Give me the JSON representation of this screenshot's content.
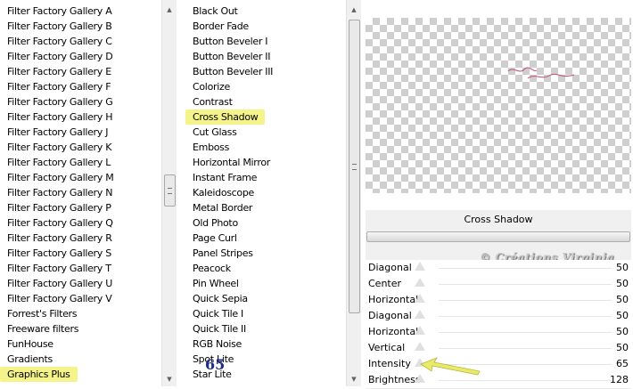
{
  "categories": {
    "items": [
      "Filter Factory Gallery A",
      "Filter Factory Gallery B",
      "Filter Factory Gallery C",
      "Filter Factory Gallery D",
      "Filter Factory Gallery E",
      "Filter Factory Gallery F",
      "Filter Factory Gallery G",
      "Filter Factory Gallery H",
      "Filter Factory Gallery J",
      "Filter Factory Gallery K",
      "Filter Factory Gallery L",
      "Filter Factory Gallery M",
      "Filter Factory Gallery N",
      "Filter Factory Gallery P",
      "Filter Factory Gallery Q",
      "Filter Factory Gallery R",
      "Filter Factory Gallery S",
      "Filter Factory Gallery T",
      "Filter Factory Gallery U",
      "Filter Factory Gallery V",
      "Forrest's Filters",
      "Freeware filters",
      "FunHouse",
      "Gradients",
      "Graphics Plus"
    ],
    "selected": "Graphics Plus"
  },
  "filters": {
    "items": [
      "Black Out",
      "Border Fade",
      "Button Beveler I",
      "Button Beveler II",
      "Button Beveler III",
      "Colorize",
      "Contrast",
      "Cross Shadow",
      "Cut Glass",
      "Emboss",
      "Horizontal Mirror",
      "Instant Frame",
      "Kaleidoscope",
      "Metal Border",
      "Old Photo",
      "Page Curl",
      "Panel Stripes",
      "Peacock",
      "Pin Wheel",
      "Quick Sepia",
      "Quick Tile I",
      "Quick Tile II",
      "RGB Noise",
      "Spot Lite",
      "Star Lite"
    ],
    "selected": "Cross Shadow"
  },
  "panel": {
    "filter_name": "Cross Shadow",
    "watermark": "© Créations Virginia"
  },
  "params": [
    {
      "label": "Diagonal",
      "value": "50"
    },
    {
      "label": "Center",
      "value": "50"
    },
    {
      "label": "Horizontal",
      "value": "50"
    },
    {
      "label": "Diagonal",
      "value": "50"
    },
    {
      "label": "Horizontal",
      "value": "50"
    },
    {
      "label": "Vertical",
      "value": "50"
    },
    {
      "label": "Intensity",
      "value": "65"
    },
    {
      "label": "Brightness",
      "value": "128"
    }
  ],
  "annotation": {
    "intensity_callout": "65"
  },
  "colors": {
    "highlight": "#f4f48a",
    "callout_text": "#1d2b8a",
    "arrow": "#e9e96a"
  }
}
